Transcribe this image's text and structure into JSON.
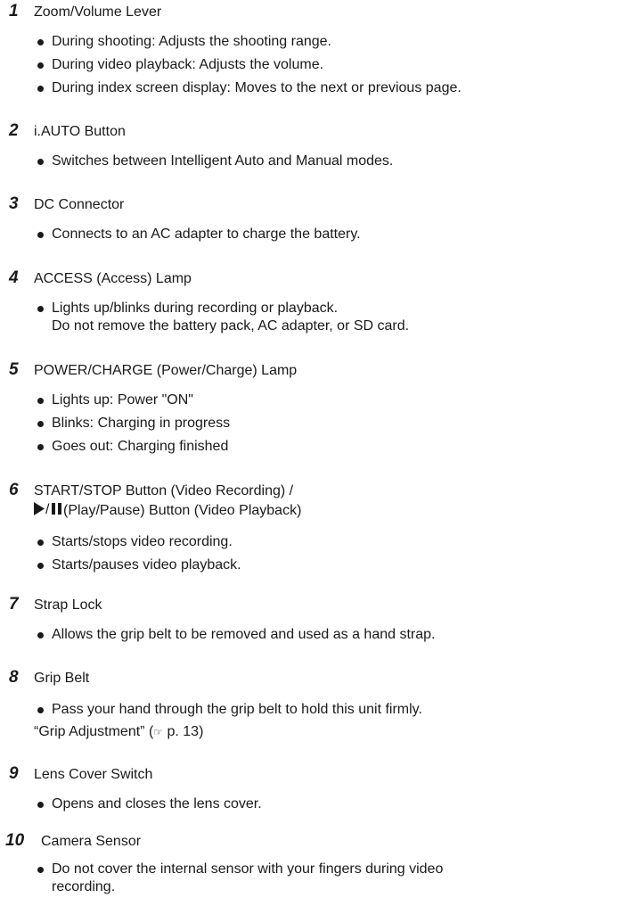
{
  "items": [
    {
      "number": "1",
      "title": "Zoom/Volume Lever",
      "bullets": [
        "During shooting: Adjusts the shooting range.",
        "During video playback: Adjusts the volume.",
        "During index screen display: Moves to the next or previous page."
      ]
    },
    {
      "number": "2",
      "title": "i.AUTO Button",
      "bullets": [
        "Switches between Intelligent Auto and Manual modes."
      ]
    },
    {
      "number": "3",
      "title": "DC Connector",
      "bullets": [
        "Connects to an AC adapter to charge the battery."
      ]
    },
    {
      "number": "4",
      "title": "ACCESS (Access) Lamp",
      "bullets": [
        "Lights up/blinks during recording or playback."
      ],
      "continuation": "Do not remove the battery pack, AC adapter, or SD card."
    },
    {
      "number": "5",
      "title": "POWER/CHARGE (Power/Charge) Lamp",
      "bullets": [
        "Lights up: Power \"ON\"",
        "Blinks: Charging in progress",
        "Goes out: Charging finished"
      ]
    },
    {
      "number": "6",
      "title": "START/STOP Button (Video Recording) /",
      "title_line2": "(Play/Pause) Button (Video Playback)",
      "title_line2_icon": "play-pause-icon",
      "bullets": [
        "Starts/stops video recording.",
        "Starts/pauses video playback."
      ]
    },
    {
      "number": "7",
      "title": "Strap Lock",
      "bullets": [
        "Allows the grip belt to be removed and used as a hand strap."
      ]
    },
    {
      "number": "8",
      "title": "Grip Belt",
      "bullets": [
        "Pass your hand through the grip belt to hold this unit firmly."
      ],
      "reference": {
        "link_text": "“Grip Adjustment”",
        "icon": "pointing-hand-icon",
        "page": "p. 13"
      }
    },
    {
      "number": "9",
      "title": "Lens Cover Switch",
      "bullets": [
        "Opens and closes the lens cover."
      ]
    },
    {
      "number": "10",
      "title": "Camera Sensor",
      "bullets": [
        "Do not cover the internal sensor with your fingers during video"
      ],
      "continuation": "recording."
    }
  ]
}
